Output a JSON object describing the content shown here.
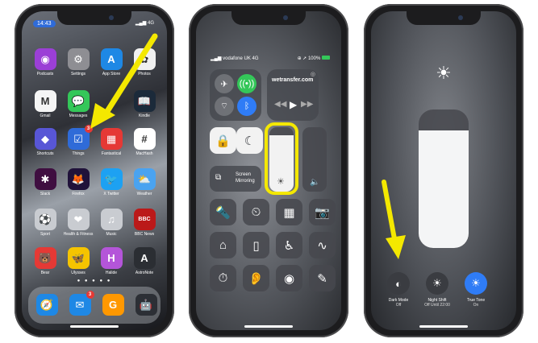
{
  "home": {
    "status_time": "14:43",
    "network": "4G",
    "apps": [
      {
        "label": "Podcasts",
        "icon": "podcasts-icon",
        "glyph": "◉",
        "color": "#9b3fd6"
      },
      {
        "label": "Settings",
        "icon": "gear-icon",
        "glyph": "⚙",
        "color": "#8e8e93"
      },
      {
        "label": "App Store",
        "icon": "app-store-icon",
        "glyph": "A",
        "color": "#1e88e5"
      },
      {
        "label": "Photos",
        "icon": "photos-icon",
        "glyph": "✿",
        "color": "#f0f0f0"
      },
      {
        "label": "Gmail",
        "icon": "gmail-icon",
        "glyph": "M",
        "color": "#f5f5f5"
      },
      {
        "label": "Messages",
        "icon": "messages-icon",
        "glyph": "💬",
        "color": "#34c759"
      },
      {
        "label": "",
        "icon": "blank-icon",
        "glyph": "",
        "color": "rgba(0,0,0,0)"
      },
      {
        "label": "Kindle",
        "icon": "kindle-icon",
        "glyph": "📖",
        "color": "#1b2a3a"
      },
      {
        "label": "Shortcuts",
        "icon": "shortcuts-icon",
        "glyph": "◆",
        "color": "#5856d6"
      },
      {
        "label": "Things",
        "icon": "things-checkbox-icon",
        "glyph": "☑",
        "color": "#2f6bd8",
        "badge": "3"
      },
      {
        "label": "Fantastical",
        "icon": "fantastical-icon",
        "glyph": "▦",
        "color": "#e53935"
      },
      {
        "label": "MacHash",
        "icon": "hash-icon",
        "glyph": "#",
        "color": "#ffffff"
      },
      {
        "label": "Slack",
        "icon": "slack-icon",
        "glyph": "✱",
        "color": "#3f0e40"
      },
      {
        "label": "Firefox",
        "icon": "firefox-icon",
        "glyph": "🦊",
        "color": "#20123a"
      },
      {
        "label": "X Twitter",
        "icon": "twitter-icon",
        "glyph": "🐦",
        "color": "#1da1f2"
      },
      {
        "label": "Weather",
        "icon": "weather-icon",
        "glyph": "⛅",
        "color": "#4aa3f0"
      },
      {
        "label": "Sport",
        "icon": "sport-folder-icon",
        "glyph": "⚽",
        "color": "#c9ccd1"
      },
      {
        "label": "Health & Fitness",
        "icon": "health-folder-icon",
        "glyph": "❤",
        "color": "#c9ccd1"
      },
      {
        "label": "Music",
        "icon": "music-folder-icon",
        "glyph": "♫",
        "color": "#c9ccd1"
      },
      {
        "label": "BBC News",
        "icon": "bbc-news-icon",
        "glyph": "BBC",
        "color": "#bb1919"
      },
      {
        "label": "Bear",
        "icon": "bear-icon",
        "glyph": "🐻",
        "color": "#e53935"
      },
      {
        "label": "Ulysses",
        "icon": "ulysses-butterfly-icon",
        "glyph": "🦋",
        "color": "#f5c400"
      },
      {
        "label": "Halide",
        "icon": "halide-icon",
        "glyph": "H",
        "color": "#b455d9"
      },
      {
        "label": "AstroNote",
        "icon": "astronote-icon",
        "glyph": "A",
        "color": "#2b2e33"
      }
    ],
    "dock": [
      {
        "icon": "safari-compass-icon",
        "glyph": "🧭",
        "color": "#1e88e5"
      },
      {
        "icon": "mail-icon",
        "glyph": "✉",
        "color": "#1e88e5",
        "badge": "3"
      },
      {
        "icon": "g-app-icon",
        "glyph": "G",
        "color": "#ff9800"
      },
      {
        "icon": "robot-app-icon",
        "glyph": "🤖",
        "color": "#2c2f35"
      }
    ]
  },
  "control_center": {
    "carrier": "vodafone UK 4G",
    "battery": "100%",
    "now_playing": "wetransfer.com",
    "screen_mirroring_line1": "Screen",
    "screen_mirroring_line2": "Mirroring"
  },
  "brightness": {
    "level": 0.85,
    "buttons": [
      {
        "label": "Dark Mode",
        "sub": "Off",
        "icon": "dark-mode-icon",
        "glyph": "◐",
        "color": "#3a3c41"
      },
      {
        "label": "Night Shift",
        "sub": "Off Until 22:00",
        "icon": "night-shift-icon",
        "glyph": "☀",
        "color": "#3a3c41"
      },
      {
        "label": "True Tone",
        "sub": "On",
        "icon": "true-tone-icon",
        "glyph": "☀",
        "color": "#2f7cf6"
      }
    ]
  },
  "colors": {
    "arrow": "#f4e800",
    "highlight": "#f4e800",
    "accent_blue": "#2f7cf6"
  }
}
